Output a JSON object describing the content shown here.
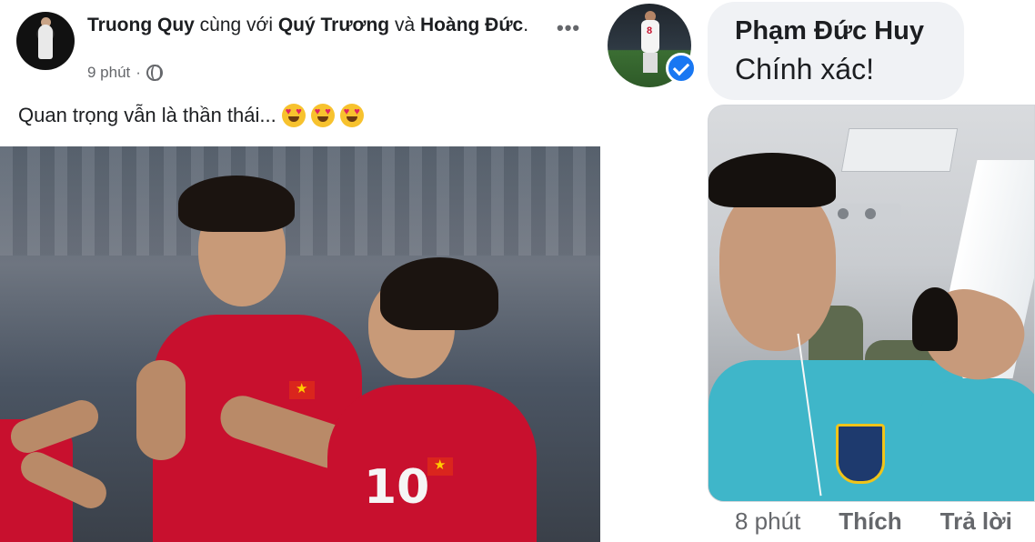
{
  "post": {
    "author": "Truong Quy",
    "with_text": "cùng với",
    "tagged_1": "Quý Trương",
    "and_text": "và",
    "tagged_2": "Hoàng Đức",
    "timestamp": "9 phút",
    "separator": "·",
    "privacy_icon": "globe-icon",
    "more_label": "•••",
    "body_text": "Quan trọng vẫn là thần thái...",
    "emoji": [
      "heart-eyes",
      "heart-eyes",
      "heart-eyes"
    ],
    "photo_jersey_number": "10"
  },
  "comment": {
    "author": "Phạm Đức Huy",
    "text": "Chính xác!",
    "verified": true,
    "avatar_jersey_number": "8",
    "actions": {
      "time": "8 phút",
      "like": "Thích",
      "reply": "Trả lời"
    }
  },
  "colors": {
    "text_primary": "#1c1e21",
    "text_secondary": "#65676b",
    "bubble_bg": "#f0f2f5",
    "verified_blue": "#1877f2",
    "jersey_red": "#c8102e"
  }
}
